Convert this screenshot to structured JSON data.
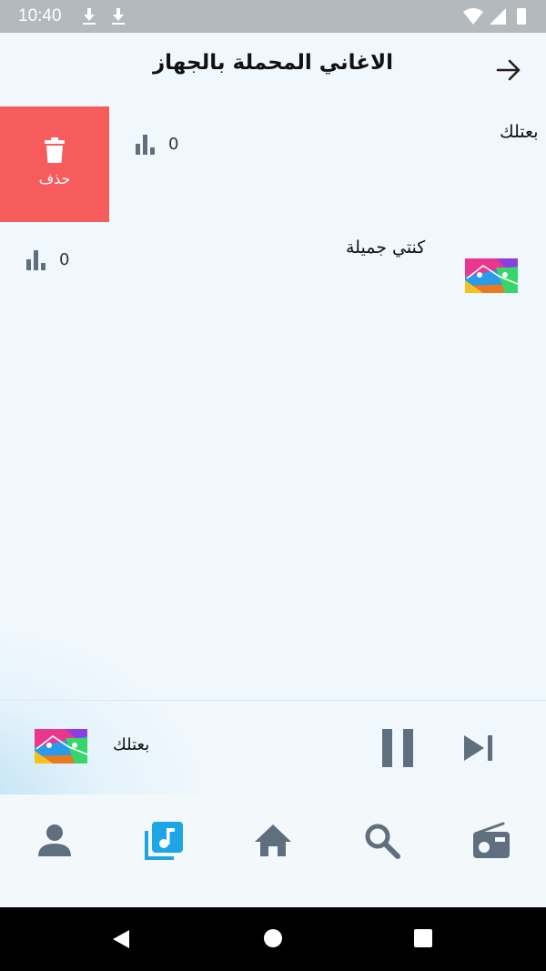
{
  "status_bar": {
    "time": "10:40"
  },
  "header": {
    "title": "الاغاني المحملة بالجهاز"
  },
  "swipe_action": {
    "delete_label": "حذف"
  },
  "songs": [
    {
      "title": "بعتلك",
      "plays": "0"
    },
    {
      "title": "كنتي جميلة",
      "plays": "0"
    }
  ],
  "now_playing": {
    "title": "بعتلك"
  },
  "bottom_nav": {
    "items": [
      "person-icon",
      "music-library-icon",
      "home-icon",
      "search-icon",
      "radio-icon"
    ],
    "active_index": 1
  },
  "colors": {
    "delete_red": "#f65c5c",
    "accent_blue": "#1ea5e6",
    "icon_gray": "#5f6f7d"
  }
}
